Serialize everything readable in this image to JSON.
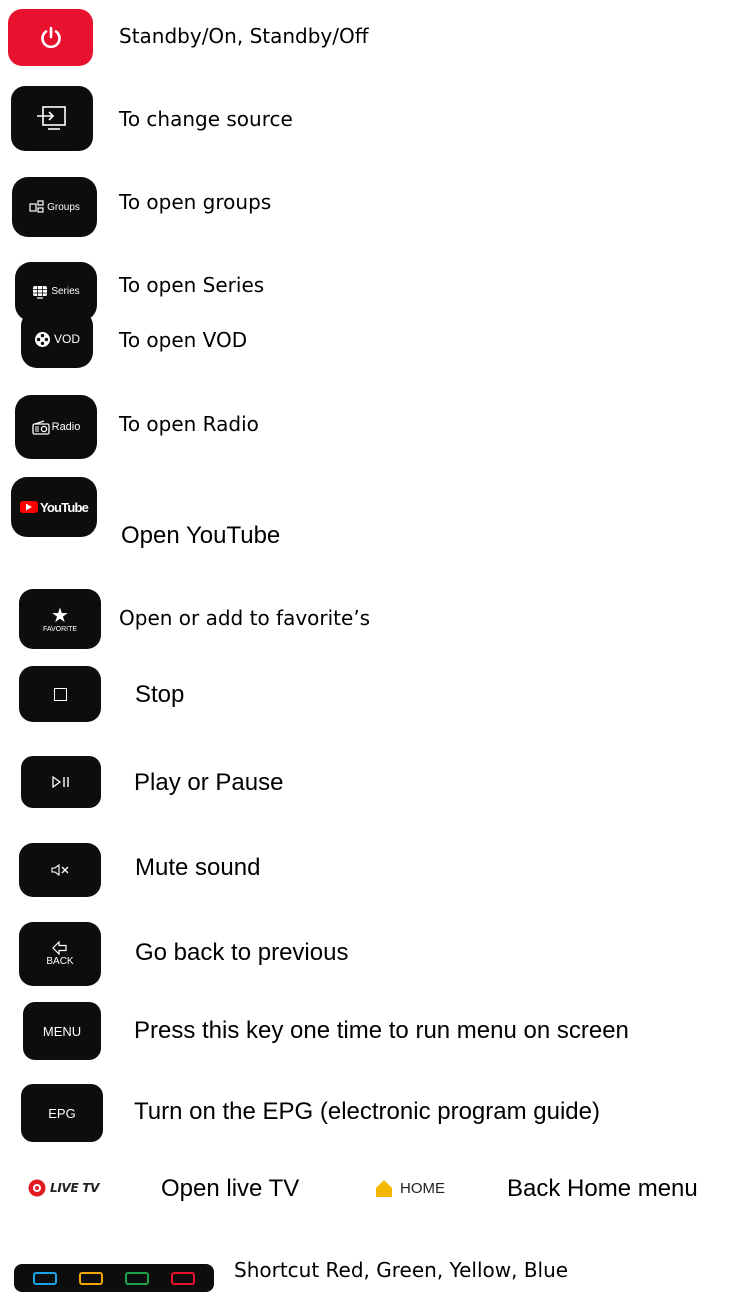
{
  "items": [
    {
      "key": "power",
      "description": "Standby/On, Standby/Off"
    },
    {
      "key": "source",
      "description": "To change source"
    },
    {
      "key": "groups",
      "key_label": "Groups",
      "description": "To open groups"
    },
    {
      "key": "series",
      "key_label": "Series",
      "description": "To open Series"
    },
    {
      "key": "vod",
      "key_label": "VOD",
      "description": "To open VOD"
    },
    {
      "key": "radio",
      "key_label": "Radio",
      "description": "To open Radio"
    },
    {
      "key": "youtube",
      "key_label": "YouTube",
      "description": "Open YouTube"
    },
    {
      "key": "favorite",
      "key_label": "FAVORITE",
      "description": "Open or add to favorite’s"
    },
    {
      "key": "stop",
      "description": "Stop"
    },
    {
      "key": "play-pause",
      "description": "Play or Pause"
    },
    {
      "key": "mute",
      "description": "Mute sound"
    },
    {
      "key": "back",
      "key_label": "BACK",
      "description": "Go back to previous"
    },
    {
      "key": "menu",
      "key_label": "MENU",
      "description": "Press this key one time to run menu on screen"
    },
    {
      "key": "epg",
      "key_label": "EPG",
      "description": "Turn on the EPG (electronic program guide)"
    }
  ],
  "live_tv": {
    "key_label": "LIVE TV",
    "description": "Open live TV"
  },
  "home": {
    "key_label": "HOME",
    "description": "Back Home menu"
  },
  "shortcut": {
    "description": "Shortcut Red, Green, Yellow, Blue"
  },
  "colors": {
    "power_red": "#e8122f",
    "key_black": "#0d0d0d",
    "youtube_red": "#ff0000",
    "home_yellow": "#f5b800",
    "live_red": "#e21b23",
    "shortcut_blue": "#1aa3e8",
    "shortcut_yellow": "#f0a800",
    "shortcut_green": "#1fa34a",
    "shortcut_red": "#e8122f"
  }
}
